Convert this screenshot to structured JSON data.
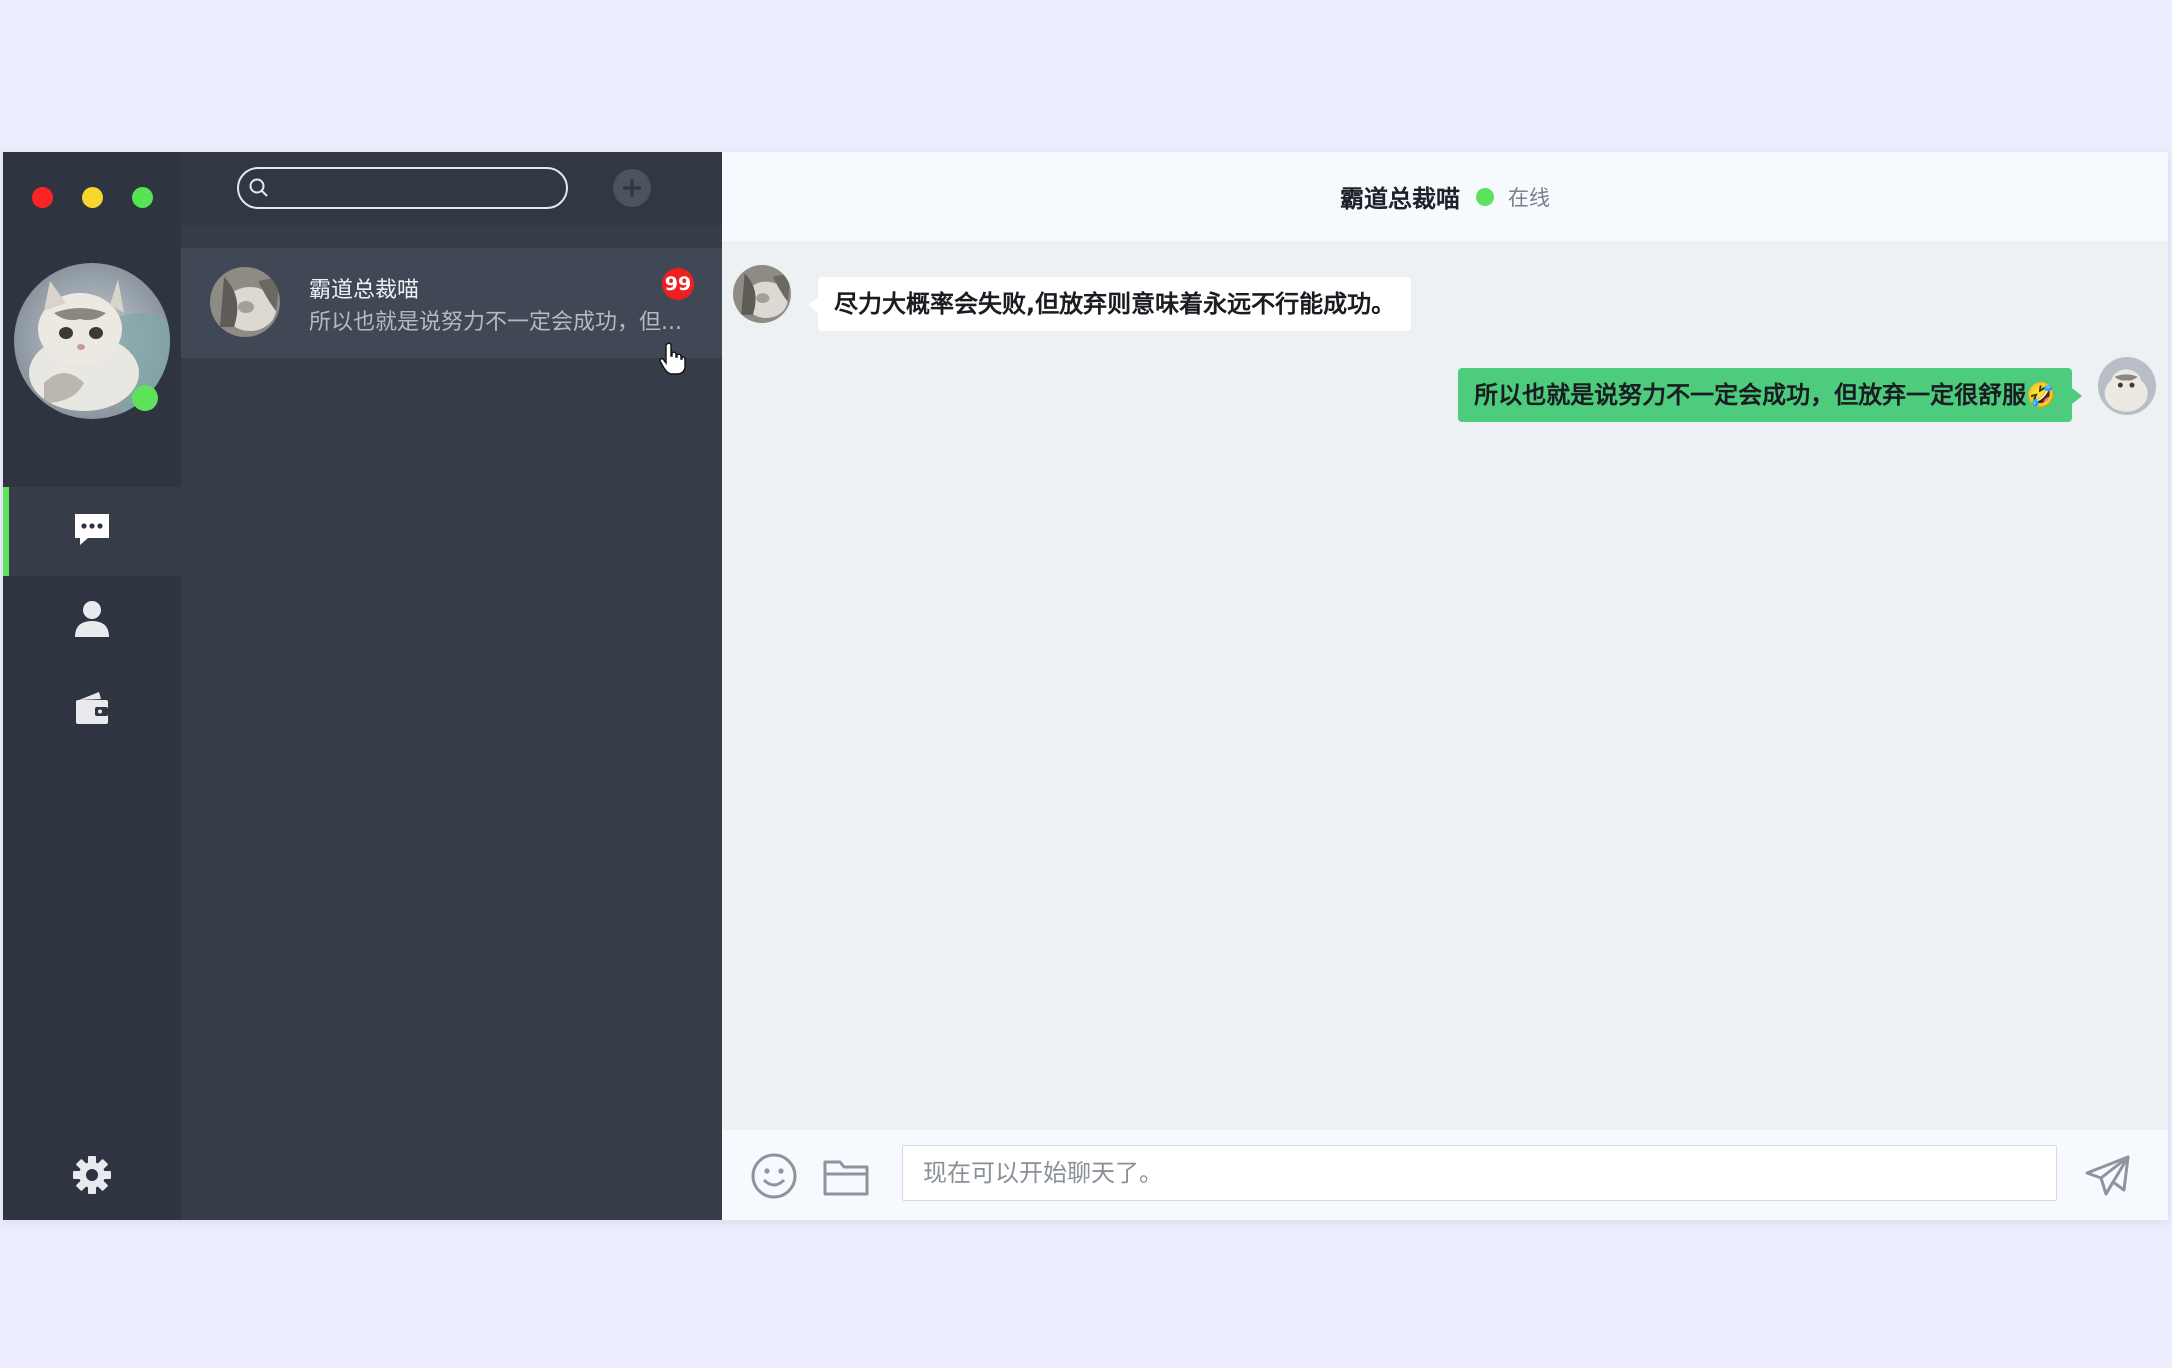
{
  "window": {
    "controls": [
      "close",
      "minimize",
      "maximize"
    ],
    "control_colors": [
      "#ff2424",
      "#f8d62e",
      "#56e454"
    ]
  },
  "profile": {
    "avatar_icon": "cat-avatar",
    "status_color": "#5ee25c"
  },
  "sidebar": {
    "accent_color": "#5ee25c",
    "nav": [
      {
        "icon": "chat-icon",
        "active": true
      },
      {
        "icon": "contacts-icon",
        "active": false
      },
      {
        "icon": "wallet-icon",
        "active": false
      }
    ],
    "settings_icon": "gear-icon"
  },
  "search": {
    "placeholder": "",
    "value": ""
  },
  "conversations": [
    {
      "name": "霸道总裁喵",
      "preview": "所以也就是说努力不一定会成功，但...",
      "unread": "99",
      "badge_color": "#ee1f1f"
    }
  ],
  "chat": {
    "title": "霸道总裁喵",
    "status": "在线",
    "status_color": "#5ee25c",
    "messages": [
      {
        "side": "left",
        "text": "尽力大概率会失败,但放弃则意味着永远不行能成功。"
      },
      {
        "side": "right",
        "text": "所以也就是说努力不一定会成功，但放弃一定很舒服🤣"
      }
    ],
    "outgoing_bubble_color": "#4ccc7c"
  },
  "composer": {
    "placeholder": "现在可以开始聊天了。",
    "value": ""
  }
}
